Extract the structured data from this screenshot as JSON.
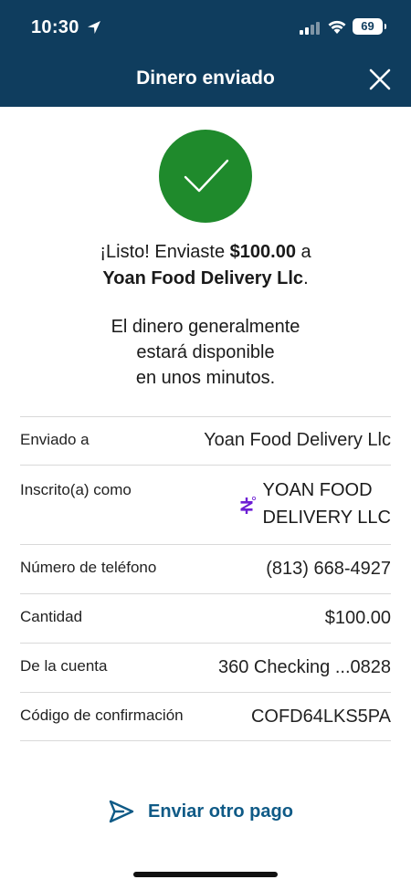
{
  "status_bar": {
    "time": "10:30",
    "battery": "69"
  },
  "header": {
    "title": "Dinero enviado"
  },
  "message": {
    "prefix": "¡Listo! Enviaste ",
    "amount": "$100.00",
    "mid": " a",
    "recipient": "Yoan Food Delivery Llc",
    "suffix": ".",
    "availability_line1": "El dinero generalmente",
    "availability_line2": "estará disponible",
    "availability_line3": "en unos minutos."
  },
  "details": [
    {
      "label": "Enviado a",
      "value": "Yoan Food Delivery Llc"
    },
    {
      "label": "Inscrito(a) como",
      "value_line1": "YOAN FOOD",
      "value_line2": "DELIVERY LLC"
    },
    {
      "label": "Número de teléfono",
      "value": "(813) 668-4927"
    },
    {
      "label": "Cantidad",
      "value": "$100.00"
    },
    {
      "label": "De la cuenta",
      "value": "360 Checking ...0828"
    },
    {
      "label": "Código de confirmación",
      "value": "COFD64LKS5PA"
    }
  ],
  "actions": {
    "send_again_label": "Enviar otro pago"
  },
  "colors": {
    "header_bg": "#0f3d5e",
    "success_green": "#1f8a2c",
    "link_blue": "#0f5a86",
    "zelle_purple": "#6d1ed4"
  },
  "icons": [
    "location-arrow-icon",
    "signal-icon",
    "wifi-icon",
    "battery-icon",
    "close-icon",
    "checkmark-icon",
    "zelle-icon",
    "send-icon"
  ]
}
